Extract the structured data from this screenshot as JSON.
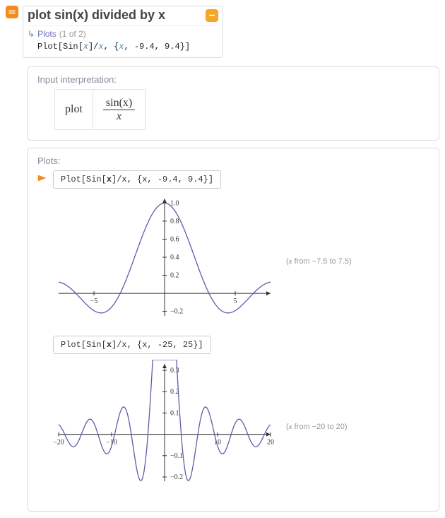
{
  "input": {
    "title": "plot sin(x) divided by x",
    "subtitle_label": "Plots",
    "subtitle_count": "(1 of 2)",
    "code_prefix": "Plot[Sin[",
    "code_sym1": "x",
    "code_mid": "]/",
    "code_sym2": "x",
    "code_suffix": ", {",
    "code_sym3": "x",
    "code_tail": ", -9.4, 9.4}]"
  },
  "pod_interpretation": {
    "title": "Input interpretation:",
    "plot_word": "plot",
    "frac_num": "sin(x)",
    "frac_den": "x"
  },
  "pod_plots": {
    "title": "Plots:",
    "items": [
      {
        "code": "Plot[Sin[<b>x</b>]/x, {x, -9.4, 9.4}]",
        "caption": "(<i>x</i> from −7.5 to 7.5)"
      },
      {
        "code": "Plot[Sin[<b>x</b>]/x, {x, -25, 25}]",
        "caption": "(<i>x</i> from −20 to 20)"
      }
    ]
  },
  "chart_data": [
    {
      "type": "line",
      "title": "sin(x)/x",
      "xrange": [
        -7.5,
        7.5
      ],
      "xticks": [
        -5,
        5
      ],
      "yrange": [
        -0.25,
        1.05
      ],
      "yticks": [
        -0.2,
        0.2,
        0.4,
        0.6,
        0.8,
        1.0
      ],
      "function": "sin(x)/x",
      "note": "continuous curve, sinc function; value 1 at x=0, oscillation damped"
    },
    {
      "type": "line",
      "title": "sin(x)/x",
      "xrange": [
        -20,
        20
      ],
      "xticks": [
        -20,
        -10,
        10,
        20
      ],
      "yrange": [
        -0.22,
        0.33
      ],
      "yticks": [
        -0.2,
        -0.1,
        0.1,
        0.2,
        0.3
      ],
      "function": "sin(x)/x",
      "note": "displayed with central spike clipped above y≈0.33"
    }
  ]
}
